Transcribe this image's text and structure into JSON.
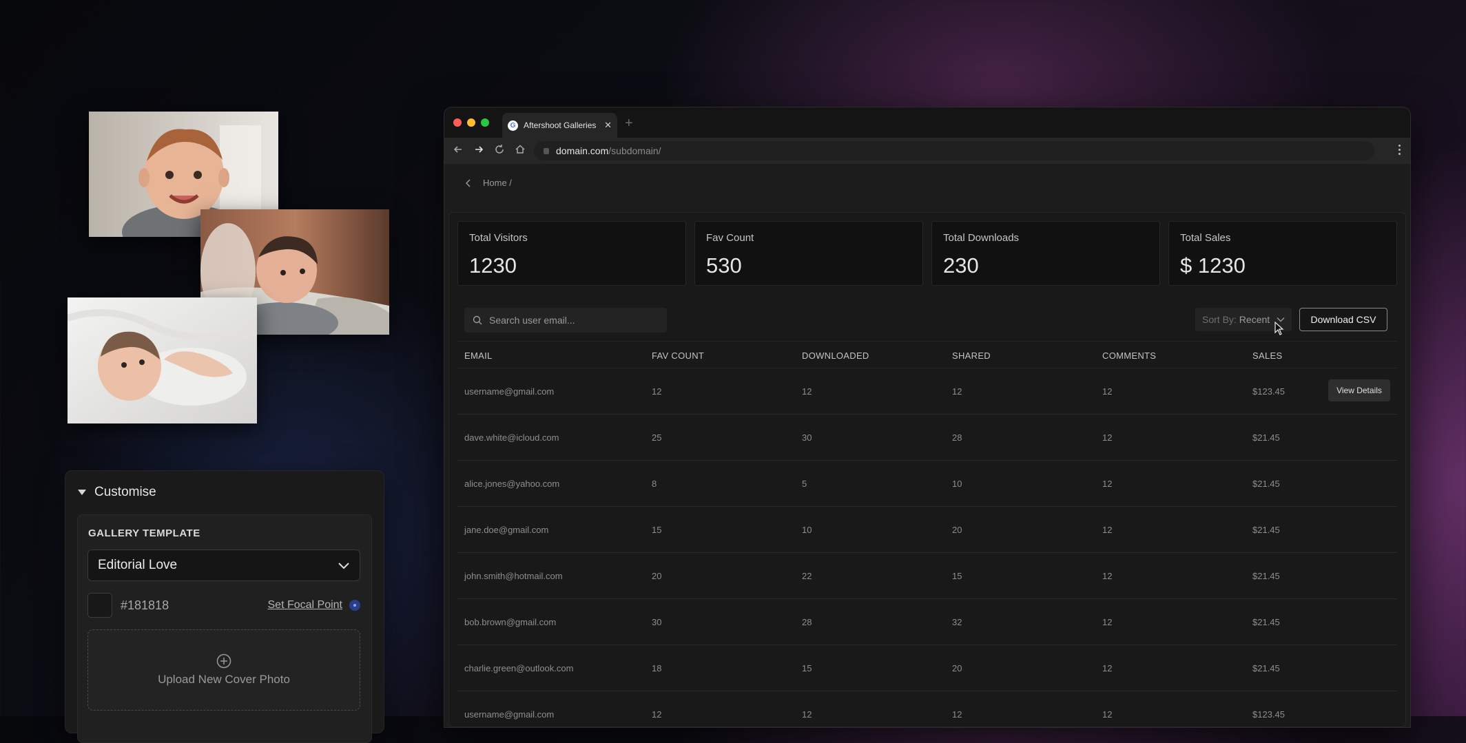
{
  "customise": {
    "title": "Customise",
    "gallery_template_label": "GALLERY TEMPLATE",
    "template_value": "Editorial Love",
    "color_hex": "#181818",
    "focal_point_label": "Set Focal Point",
    "upload_label": "Upload  New Cover Photo"
  },
  "browser": {
    "tab_title": "Aftershoot Galleries",
    "url_domain": "domain.com",
    "url_path": "/subdomain/",
    "traffic_colors": [
      "#ff5f57",
      "#febc2e",
      "#28c840"
    ]
  },
  "page": {
    "breadcrumb": "Home /",
    "stats": [
      {
        "label": "Total Visitors",
        "value": "1230"
      },
      {
        "label": "Fav Count",
        "value": "530"
      },
      {
        "label": "Total Downloads",
        "value": "230"
      },
      {
        "label": "Total Sales",
        "value": "$ 1230"
      }
    ],
    "search_placeholder": "Search user email...",
    "sort_label": "Sort By:",
    "sort_value": "Recent",
    "download_csv": "Download CSV",
    "columns": [
      "EMAIL",
      "FAV COUNT",
      "DOWNLOADED",
      "SHARED",
      "COMMENTS",
      "SALES"
    ],
    "view_details": "View Details",
    "rows": [
      [
        "username@gmail.com",
        "12",
        "12",
        "12",
        "12",
        "$123.45"
      ],
      [
        "dave.white@icloud.com",
        "25",
        "30",
        "28",
        "12",
        "$21.45"
      ],
      [
        "alice.jones@yahoo.com",
        "8",
        "5",
        "10",
        "12",
        "$21.45"
      ],
      [
        "jane.doe@gmail.com",
        "15",
        "10",
        "20",
        "12",
        "$21.45"
      ],
      [
        "john.smith@hotmail.com",
        "20",
        "22",
        "15",
        "12",
        "$21.45"
      ],
      [
        "bob.brown@gmail.com",
        "30",
        "28",
        "32",
        "12",
        "$21.45"
      ],
      [
        "charlie.green@outlook.com",
        "18",
        "15",
        "20",
        "12",
        "$21.45"
      ],
      [
        "username@gmail.com",
        "12",
        "12",
        "12",
        "12",
        "$123.45"
      ]
    ]
  }
}
